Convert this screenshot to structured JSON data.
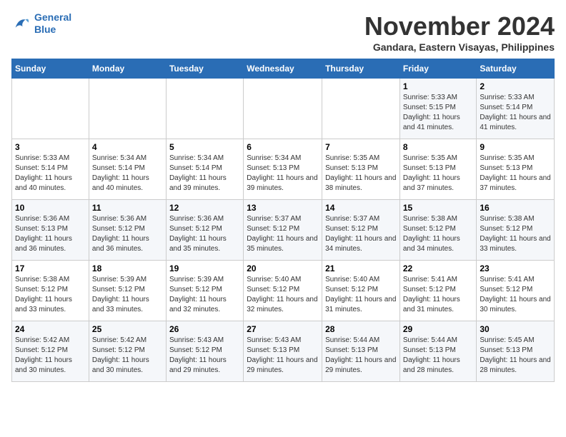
{
  "logo": {
    "line1": "General",
    "line2": "Blue"
  },
  "title": "November 2024",
  "location": "Gandara, Eastern Visayas, Philippines",
  "weekdays": [
    "Sunday",
    "Monday",
    "Tuesday",
    "Wednesday",
    "Thursday",
    "Friday",
    "Saturday"
  ],
  "weeks": [
    [
      {
        "day": "",
        "sunrise": "",
        "sunset": "",
        "daylight": ""
      },
      {
        "day": "",
        "sunrise": "",
        "sunset": "",
        "daylight": ""
      },
      {
        "day": "",
        "sunrise": "",
        "sunset": "",
        "daylight": ""
      },
      {
        "day": "",
        "sunrise": "",
        "sunset": "",
        "daylight": ""
      },
      {
        "day": "",
        "sunrise": "",
        "sunset": "",
        "daylight": ""
      },
      {
        "day": "1",
        "sunrise": "Sunrise: 5:33 AM",
        "sunset": "Sunset: 5:15 PM",
        "daylight": "Daylight: 11 hours and 41 minutes."
      },
      {
        "day": "2",
        "sunrise": "Sunrise: 5:33 AM",
        "sunset": "Sunset: 5:14 PM",
        "daylight": "Daylight: 11 hours and 41 minutes."
      }
    ],
    [
      {
        "day": "3",
        "sunrise": "Sunrise: 5:33 AM",
        "sunset": "Sunset: 5:14 PM",
        "daylight": "Daylight: 11 hours and 40 minutes."
      },
      {
        "day": "4",
        "sunrise": "Sunrise: 5:34 AM",
        "sunset": "Sunset: 5:14 PM",
        "daylight": "Daylight: 11 hours and 40 minutes."
      },
      {
        "day": "5",
        "sunrise": "Sunrise: 5:34 AM",
        "sunset": "Sunset: 5:14 PM",
        "daylight": "Daylight: 11 hours and 39 minutes."
      },
      {
        "day": "6",
        "sunrise": "Sunrise: 5:34 AM",
        "sunset": "Sunset: 5:13 PM",
        "daylight": "Daylight: 11 hours and 39 minutes."
      },
      {
        "day": "7",
        "sunrise": "Sunrise: 5:35 AM",
        "sunset": "Sunset: 5:13 PM",
        "daylight": "Daylight: 11 hours and 38 minutes."
      },
      {
        "day": "8",
        "sunrise": "Sunrise: 5:35 AM",
        "sunset": "Sunset: 5:13 PM",
        "daylight": "Daylight: 11 hours and 37 minutes."
      },
      {
        "day": "9",
        "sunrise": "Sunrise: 5:35 AM",
        "sunset": "Sunset: 5:13 PM",
        "daylight": "Daylight: 11 hours and 37 minutes."
      }
    ],
    [
      {
        "day": "10",
        "sunrise": "Sunrise: 5:36 AM",
        "sunset": "Sunset: 5:13 PM",
        "daylight": "Daylight: 11 hours and 36 minutes."
      },
      {
        "day": "11",
        "sunrise": "Sunrise: 5:36 AM",
        "sunset": "Sunset: 5:12 PM",
        "daylight": "Daylight: 11 hours and 36 minutes."
      },
      {
        "day": "12",
        "sunrise": "Sunrise: 5:36 AM",
        "sunset": "Sunset: 5:12 PM",
        "daylight": "Daylight: 11 hours and 35 minutes."
      },
      {
        "day": "13",
        "sunrise": "Sunrise: 5:37 AM",
        "sunset": "Sunset: 5:12 PM",
        "daylight": "Daylight: 11 hours and 35 minutes."
      },
      {
        "day": "14",
        "sunrise": "Sunrise: 5:37 AM",
        "sunset": "Sunset: 5:12 PM",
        "daylight": "Daylight: 11 hours and 34 minutes."
      },
      {
        "day": "15",
        "sunrise": "Sunrise: 5:38 AM",
        "sunset": "Sunset: 5:12 PM",
        "daylight": "Daylight: 11 hours and 34 minutes."
      },
      {
        "day": "16",
        "sunrise": "Sunrise: 5:38 AM",
        "sunset": "Sunset: 5:12 PM",
        "daylight": "Daylight: 11 hours and 33 minutes."
      }
    ],
    [
      {
        "day": "17",
        "sunrise": "Sunrise: 5:38 AM",
        "sunset": "Sunset: 5:12 PM",
        "daylight": "Daylight: 11 hours and 33 minutes."
      },
      {
        "day": "18",
        "sunrise": "Sunrise: 5:39 AM",
        "sunset": "Sunset: 5:12 PM",
        "daylight": "Daylight: 11 hours and 33 minutes."
      },
      {
        "day": "19",
        "sunrise": "Sunrise: 5:39 AM",
        "sunset": "Sunset: 5:12 PM",
        "daylight": "Daylight: 11 hours and 32 minutes."
      },
      {
        "day": "20",
        "sunrise": "Sunrise: 5:40 AM",
        "sunset": "Sunset: 5:12 PM",
        "daylight": "Daylight: 11 hours and 32 minutes."
      },
      {
        "day": "21",
        "sunrise": "Sunrise: 5:40 AM",
        "sunset": "Sunset: 5:12 PM",
        "daylight": "Daylight: 11 hours and 31 minutes."
      },
      {
        "day": "22",
        "sunrise": "Sunrise: 5:41 AM",
        "sunset": "Sunset: 5:12 PM",
        "daylight": "Daylight: 11 hours and 31 minutes."
      },
      {
        "day": "23",
        "sunrise": "Sunrise: 5:41 AM",
        "sunset": "Sunset: 5:12 PM",
        "daylight": "Daylight: 11 hours and 30 minutes."
      }
    ],
    [
      {
        "day": "24",
        "sunrise": "Sunrise: 5:42 AM",
        "sunset": "Sunset: 5:12 PM",
        "daylight": "Daylight: 11 hours and 30 minutes."
      },
      {
        "day": "25",
        "sunrise": "Sunrise: 5:42 AM",
        "sunset": "Sunset: 5:12 PM",
        "daylight": "Daylight: 11 hours and 30 minutes."
      },
      {
        "day": "26",
        "sunrise": "Sunrise: 5:43 AM",
        "sunset": "Sunset: 5:12 PM",
        "daylight": "Daylight: 11 hours and 29 minutes."
      },
      {
        "day": "27",
        "sunrise": "Sunrise: 5:43 AM",
        "sunset": "Sunset: 5:13 PM",
        "daylight": "Daylight: 11 hours and 29 minutes."
      },
      {
        "day": "28",
        "sunrise": "Sunrise: 5:44 AM",
        "sunset": "Sunset: 5:13 PM",
        "daylight": "Daylight: 11 hours and 29 minutes."
      },
      {
        "day": "29",
        "sunrise": "Sunrise: 5:44 AM",
        "sunset": "Sunset: 5:13 PM",
        "daylight": "Daylight: 11 hours and 28 minutes."
      },
      {
        "day": "30",
        "sunrise": "Sunrise: 5:45 AM",
        "sunset": "Sunset: 5:13 PM",
        "daylight": "Daylight: 11 hours and 28 minutes."
      }
    ]
  ]
}
